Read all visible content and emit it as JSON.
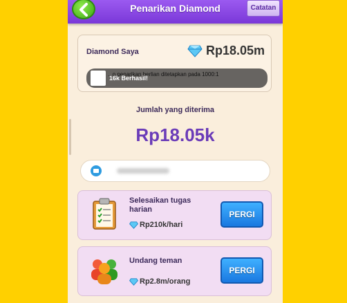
{
  "header": {
    "title": "Penarikan Diamond",
    "catatan_label": "Catatan",
    "back_icon": "chevron-left-icon"
  },
  "diamond": {
    "label": "Diamond Saya",
    "value": "Rp18.05m",
    "notice_text": "...o penarikan berlian ditetapkan pada 1000:1",
    "toast_text": "16k Berhasil!"
  },
  "receive": {
    "label": "Jumlah yang diterima",
    "value": "Rp18.05k"
  },
  "account": {
    "icon": "wallet-icon"
  },
  "tasks": [
    {
      "title": "Selesaikan tugas harian",
      "reward": "Rp210k/hari",
      "button": "PERGI",
      "icon": "clipboard-icon"
    },
    {
      "title": "Undang teman",
      "reward": "Rp2.8m/orang",
      "button": "PERGI",
      "icon": "people-icon"
    }
  ],
  "colors": {
    "background": "#FFD000",
    "header": "#8A48E4",
    "accent_text": "#6A3BB8",
    "button": "#1A78E0"
  }
}
